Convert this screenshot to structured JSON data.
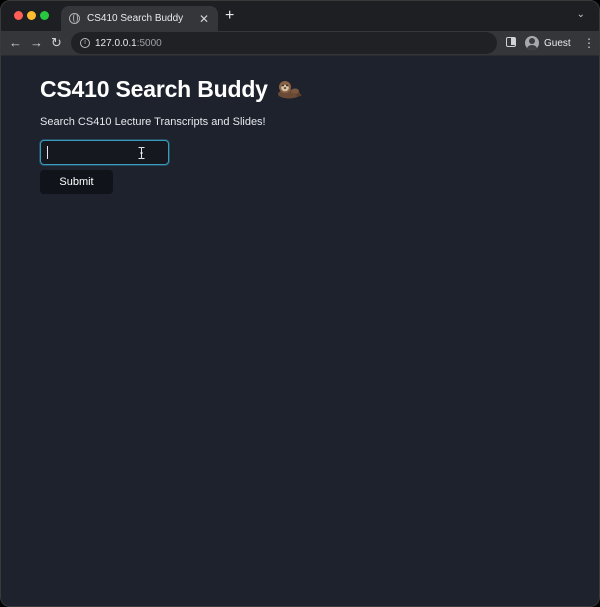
{
  "browser": {
    "tab": {
      "title": "CS410 Search Buddy",
      "close_icon": "close-icon",
      "favicon": "globe-icon"
    },
    "new_tab_label": "+",
    "tab_menu_icon": "chevron-down-icon",
    "address_bar": {
      "host": "127.0.0.1",
      "port": ":5000"
    },
    "profile": {
      "name": "Guest"
    }
  },
  "page": {
    "heading": "CS410 Search Buddy",
    "heading_icon": "otter-icon",
    "subtitle": "Search CS410 Lecture Transcripts and Slides!",
    "search": {
      "value": "",
      "placeholder": ""
    },
    "submit_label": "Submit"
  },
  "colors": {
    "page_background": "#1d222d",
    "input_focus_border": "#3a9bbd",
    "button_background": "#10131a",
    "text": "#ffffff"
  }
}
